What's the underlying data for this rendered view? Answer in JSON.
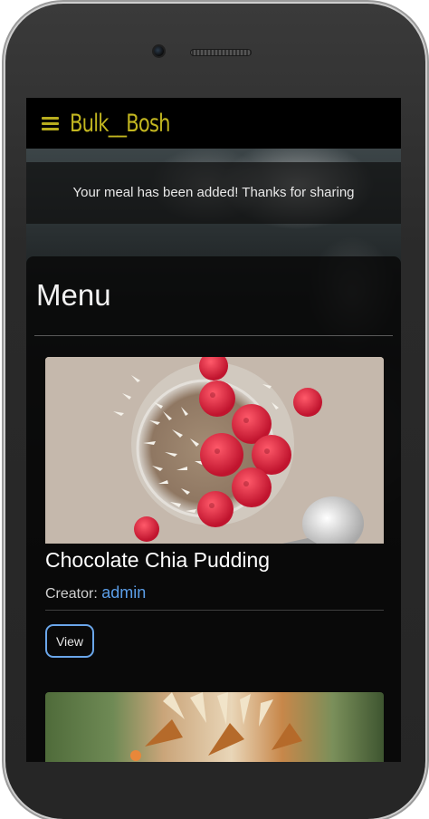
{
  "navbar": {
    "brand": "Bulk__Bosh",
    "menu_icon": "hamburger-menu-icon",
    "brand_color": "#c2b620"
  },
  "flash": {
    "message": "Your meal has been added! Thanks for sharing"
  },
  "menu": {
    "title": "Menu",
    "cards": [
      {
        "title": "Chocolate Chia Pudding",
        "creator_label": "Creator:",
        "creator_name": "admin",
        "button_label": "View"
      }
    ]
  },
  "colors": {
    "accent_link": "#5b9ee8",
    "button_border": "#6aa6ea"
  }
}
